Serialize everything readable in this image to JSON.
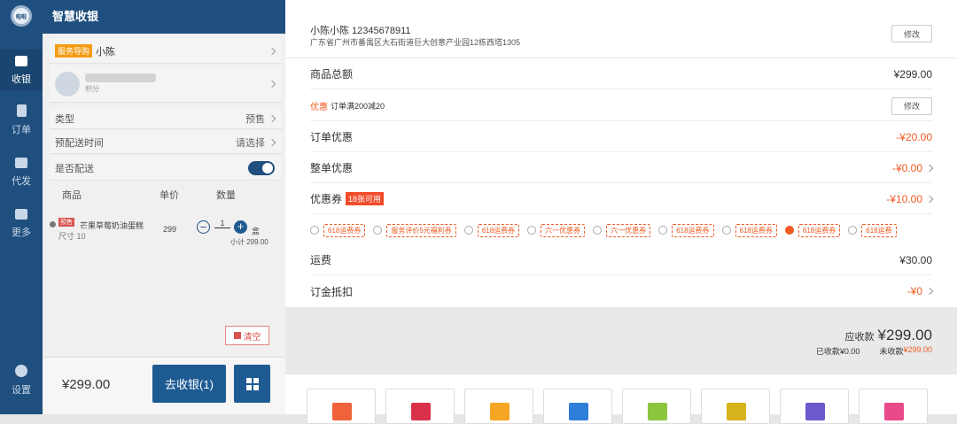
{
  "nav": {
    "logo": "啦啦",
    "items": [
      {
        "label": "收银",
        "icon": "monitor-icon"
      },
      {
        "label": "订单",
        "icon": "document-icon"
      },
      {
        "label": "代发",
        "icon": "grid-person-icon"
      },
      {
        "label": "更多",
        "icon": "apps-icon"
      },
      {
        "label": "设置",
        "icon": "gear-icon"
      }
    ]
  },
  "panel": {
    "title": "智慧收银",
    "guide_badge": "服务导购",
    "guide_name": "小陈",
    "member_sub": "积分",
    "type_label": "类型",
    "type_value": "预售",
    "delivery_time_label": "预配送时间",
    "delivery_time_value": "请选择",
    "delivery_label": "是否配送",
    "table_headers": [
      "商品",
      "单价",
      "数量"
    ],
    "product": {
      "tag": "预售",
      "name": "芒果草莓奶油蛋糕",
      "spec": "尺寸 10",
      "price": "299",
      "qty": "1",
      "unit": "盒",
      "subtotal": "小计 299.00"
    },
    "clear_label": "清空"
  },
  "footer": {
    "total": "¥299.00",
    "cashier_label": "去收银(1)"
  },
  "address": {
    "name_phone": "小陈小陈 12345678911",
    "address": "广东省广州市番禺区大石街道巨大创意产业园12栋西塔1305",
    "edit_label": "修改"
  },
  "rows": {
    "goods_total_label": "商品总额",
    "goods_total_value": "¥299.00",
    "discount_tag": "优惠",
    "discount_text": "订单满200减20",
    "discount_edit": "修改",
    "order_discount_label": "订单优惠",
    "order_discount_value": "-¥20.00",
    "whole_discount_label": "整单优惠",
    "whole_discount_value": "-¥0.00",
    "coupon_label": "优惠券",
    "coupon_badge": "18张可用",
    "coupon_value": "-¥10.00",
    "freight_label": "运费",
    "freight_value": "¥30.00",
    "deposit_label": "订金抵扣",
    "deposit_value": "-¥0"
  },
  "coupons": [
    {
      "label": "618运费券",
      "selected": false
    },
    {
      "label": "服务评价5元福利券",
      "selected": false
    },
    {
      "label": "618运费券",
      "selected": false
    },
    {
      "label": "六一优惠券",
      "selected": false
    },
    {
      "label": "六一优惠券",
      "selected": false
    },
    {
      "label": "618运费券",
      "selected": false
    },
    {
      "label": "618运费券",
      "selected": false
    },
    {
      "label": "618运费券",
      "selected": true
    },
    {
      "label": "618运费",
      "selected": false
    }
  ],
  "summary": {
    "due_label": "应收款",
    "due_value": "¥299.00",
    "received": "已收款¥0.00",
    "unreceived_label": "未收款",
    "unreceived_value": "¥299.00"
  },
  "pay_methods": [
    {
      "icon": "wallet-icon",
      "color": "#f0633a"
    },
    {
      "icon": "card-icon",
      "color": "#d9314a"
    },
    {
      "icon": "cash-icon",
      "color": "#f5a623"
    },
    {
      "icon": "bank-icon",
      "color": "#2f7fd8"
    },
    {
      "icon": "wechat-icon",
      "color": "#8cc63f"
    },
    {
      "icon": "coin-icon",
      "color": "#d6b21c"
    },
    {
      "icon": "pos-icon",
      "color": "#6a5acd"
    },
    {
      "icon": "voucher-icon",
      "color": "#e84a8a"
    }
  ]
}
